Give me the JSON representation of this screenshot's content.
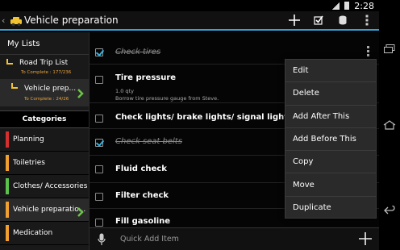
{
  "status": {
    "time": "2:28"
  },
  "actionbar": {
    "title": "Vehicle preparation",
    "icons": [
      "car-icon",
      "add-icon",
      "checkbox-icon",
      "database-icon",
      "overflow-icon"
    ]
  },
  "sidebar": {
    "header": "My Lists",
    "lists": [
      {
        "name": "Road Trip List",
        "sub": "To Complete : 177/236"
      },
      {
        "name": "Vehicle prep...",
        "sub": "To Complete : 24/26"
      }
    ],
    "categories_header": "Categories",
    "categories": [
      {
        "name": "Planning",
        "color": "#d62f2f"
      },
      {
        "name": "Toiletries",
        "color": "#f0a030"
      },
      {
        "name": "Clothes/ Accessories",
        "color": "#5bc24b"
      },
      {
        "name": "Vehicle preparatio...",
        "color": "#f0a030"
      },
      {
        "name": "Medication",
        "color": "#f0a030"
      }
    ]
  },
  "items": [
    {
      "text": "Check tires",
      "done": true
    },
    {
      "text": "Tire pressure",
      "qty": "1.0 qty",
      "note": "Borrow tire pressure gauge from Steve.",
      "done": false
    },
    {
      "text": "Check lights/ brake lights/ signal lights",
      "done": false
    },
    {
      "text": "Check seat belts",
      "done": true
    },
    {
      "text": "Fluid check",
      "done": false
    },
    {
      "text": "Filter check",
      "done": false
    },
    {
      "text": "Fill gasoline",
      "done": false
    }
  ],
  "menu": [
    "Edit",
    "Delete",
    "Add After This",
    "Add Before This",
    "Copy",
    "Move",
    "Duplicate"
  ],
  "quickadd": {
    "placeholder": "Quick Add Item"
  },
  "colors": {
    "accent": "#33b5e5",
    "check": "#33b5e5",
    "arrow": "#6cc24a",
    "sub": "#e8a43c"
  }
}
